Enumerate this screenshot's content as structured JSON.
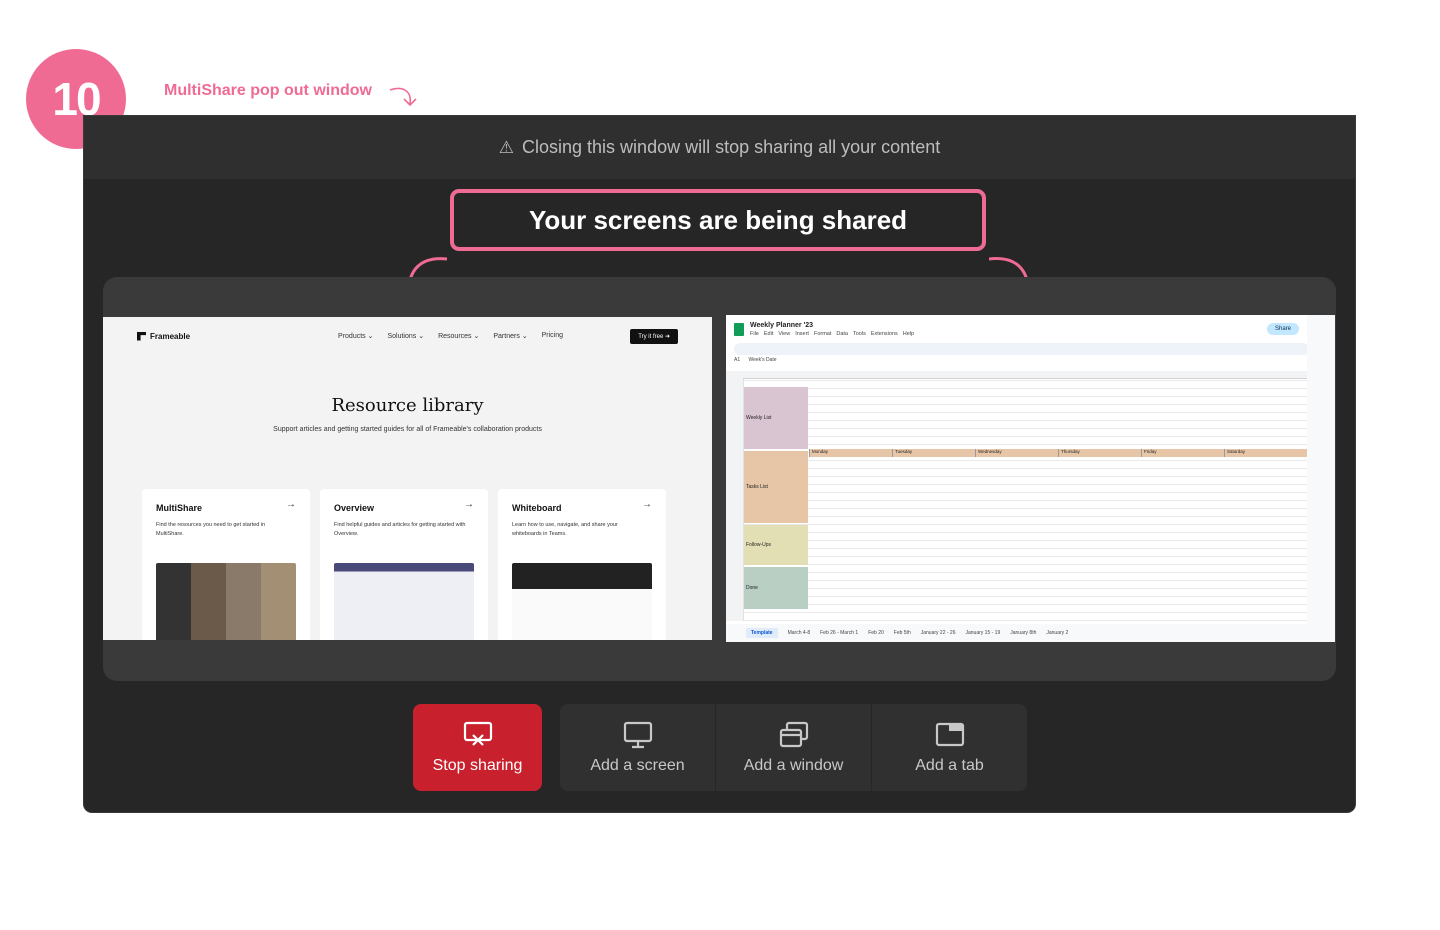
{
  "annotation": {
    "step_number": "10",
    "label": "MultiShare pop out window"
  },
  "window": {
    "warning_text": "Closing this window will stop sharing all your content",
    "headline": "Your screens are being shared"
  },
  "preview_frameable": {
    "logo": "Frameable",
    "nav": [
      "Products ⌄",
      "Solutions ⌄",
      "Resources ⌄",
      "Partners ⌄",
      "Pricing"
    ],
    "cta": "Try it free ➜",
    "title": "Resource library",
    "subtitle": "Support articles and getting started guides for all of Frameable's collaboration products",
    "cards": [
      {
        "title": "MultiShare",
        "text": "Find the resources you need to get started in MultiShare."
      },
      {
        "title": "Overview",
        "text": "Find helpful guides and articles for getting started with Overview."
      },
      {
        "title": "Whiteboard",
        "text": "Learn how to use, navigate, and share your whiteboards in Teams."
      }
    ]
  },
  "preview_sheets": {
    "title": "Weekly Planner '23",
    "menu": [
      "File",
      "Edit",
      "View",
      "Insert",
      "Format",
      "Data",
      "Tools",
      "Extensions",
      "Help"
    ],
    "share": "Share",
    "cell_ref": "A1",
    "formula": "Week's Date",
    "rows": [
      "Weekly List",
      "Tasks List",
      "Follow-Ups",
      "Done"
    ],
    "days": [
      "Monday",
      "Tuesday",
      "Wednesday",
      "Thursday",
      "Friday",
      "Saturday"
    ],
    "tabs": [
      "Template",
      "March 4-8",
      "Feb 26 - March 1",
      "Feb 20",
      "Feb 5th",
      "January 22 - 26",
      "January 15 - 19",
      "January 8th",
      "January 2"
    ]
  },
  "controls": {
    "stop": "Stop sharing",
    "add_screen": "Add a screen",
    "add_window": "Add a window",
    "add_tab": "Add a tab"
  },
  "colors": {
    "accent_pink": "#f06b93",
    "stop_red": "#c9202e",
    "window_bg": "#262626"
  }
}
